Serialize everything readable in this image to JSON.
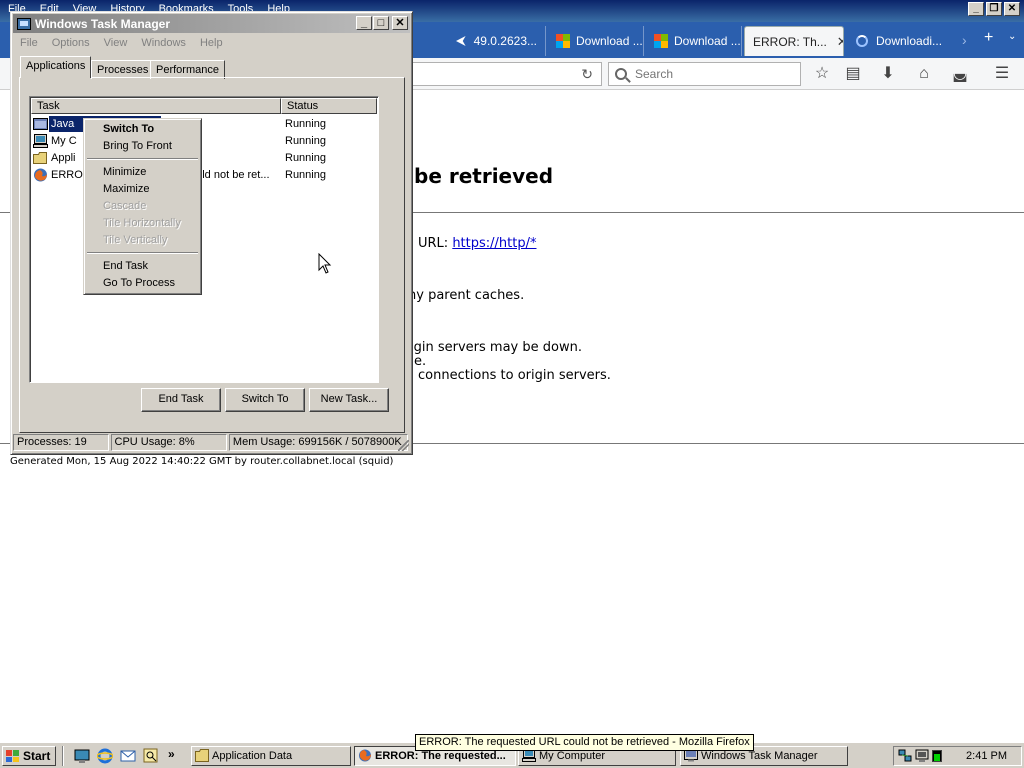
{
  "firefox": {
    "menu": [
      "File",
      "Edit",
      "View",
      "History",
      "Bookmarks",
      "Tools",
      "Help"
    ],
    "tabs": [
      {
        "label": "49.0.2623..."
      },
      {
        "label": "Download ..."
      },
      {
        "label": "Download ..."
      },
      {
        "label": "ERROR: Th..."
      },
      {
        "label": "Downloadi..."
      }
    ],
    "search_placeholder": "Search",
    "page": {
      "heading_fragment": "be retrieved",
      "url_prefix": "URL:",
      "url_link": "https://http/*",
      "line_parent": "ny parent caches.",
      "line_origin_down": "igin servers may be down.",
      "line_e": "e.",
      "line_connections": "connections to origin servers.",
      "generated": "Generated Mon, 15 Aug 2022 14:40:22 GMT by router.collabnet.local (squid)"
    }
  },
  "task_manager": {
    "title": "Windows Task Manager",
    "menu": [
      "File",
      "Options",
      "View",
      "Windows",
      "Help"
    ],
    "tabs": [
      "Applications",
      "Processes",
      "Performance"
    ],
    "columns": {
      "task": "Task",
      "status": "Status"
    },
    "rows": [
      {
        "task": "Java",
        "status": "Running",
        "icon": "java-window-icon"
      },
      {
        "task": "My C",
        "status": "Running",
        "icon": "my-computer-icon"
      },
      {
        "task": "Appli",
        "status": "Running",
        "icon": "folder-icon"
      },
      {
        "task": "ERRO",
        "task_tail": "ould not be ret...",
        "status": "Running",
        "icon": "firefox-icon"
      }
    ],
    "buttons": {
      "end_task": "End Task",
      "switch_to": "Switch To",
      "new_task": "New Task..."
    },
    "status_bar": {
      "processes": "Processes: 19",
      "cpu": "CPU Usage: 8%",
      "mem": "Mem Usage: 699156K / 5078900K"
    },
    "context_menu": {
      "switch_to": "Switch To",
      "bring_to_front": "Bring To Front",
      "minimize": "Minimize",
      "maximize": "Maximize",
      "cascade": "Cascade",
      "tile_horizontally": "Tile Horizontally",
      "tile_vertically": "Tile Vertically",
      "end_task": "End Task",
      "go_to_process": "Go To Process"
    }
  },
  "taskbar": {
    "start": "Start",
    "buttons": [
      {
        "label": "Application Data",
        "icon": "folder-icon"
      },
      {
        "label": "ERROR: The requested...",
        "icon": "firefox-icon",
        "pressed": true
      },
      {
        "label": "My Computer",
        "icon": "my-computer-icon"
      },
      {
        "label": "Windows Task Manager",
        "icon": "task-manager-icon"
      }
    ],
    "clock": "2:41 PM",
    "tooltip": "ERROR: The requested URL could not be retrieved - Mozilla Firefox"
  },
  "colors": {
    "selection": "#0a246a",
    "window_face": "#d4d0c8",
    "firefox_tabstrip": "#2b5fae",
    "link": "#0000cc"
  }
}
